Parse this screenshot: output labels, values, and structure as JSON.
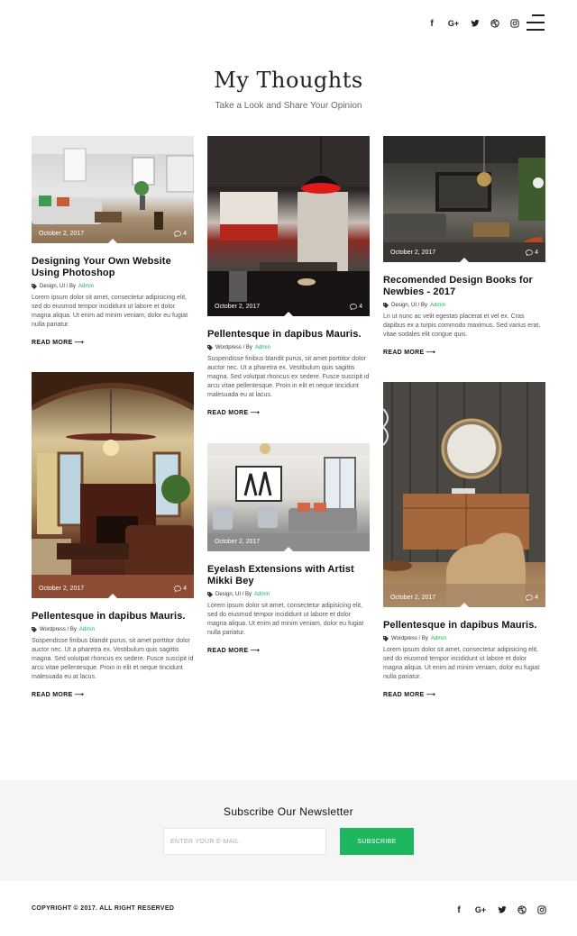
{
  "header": {
    "social": [
      {
        "icon": "facebook-icon",
        "glyph": "f"
      },
      {
        "icon": "google-plus-icon",
        "glyph": "G+"
      },
      {
        "icon": "twitter-icon",
        "glyph": ""
      },
      {
        "icon": "dribbble-icon",
        "glyph": ""
      },
      {
        "icon": "instagram-icon",
        "glyph": ""
      }
    ],
    "menu_icon": "hamburger-menu-icon"
  },
  "hero": {
    "title": "My Thoughts",
    "subtitle": "Take a Look and Share Your Opinion"
  },
  "posts": [
    {
      "date": "October 2, 2017",
      "comments": "4",
      "title": "Designing Your Own Website Using Photoshop",
      "categories": "Design, UI / By",
      "author": "Admin",
      "excerpt": "Lorem ipsum dolor sit amet, consectetur adipisicing elit, sed do eiusmod tempor incididunt ut labore et dolor magna aliqua. Ut enim ad minim veniam, dolor eu fugiat nulla pariatur.",
      "read_more": "READ MORE"
    },
    {
      "date": "October 2, 2017",
      "comments": "4",
      "title": "Pellentesque in dapibus Mauris.",
      "categories": "Wordpress / By",
      "author": "Admin",
      "excerpt": "Suspendisse finibus blandit purus, sit amet porttitor dolor auctor nec. Ut a pharetra ex. Vestibulum quis sagittis magna. Sed volutpat rhoncus ex sedere. Fusce suscipit id arcu vitae pellentesque. Proin in elit et neque tincidunt malesuada eu at lacus.",
      "read_more": "READ MORE"
    },
    {
      "date": "October 2, 2017",
      "comments": "4",
      "title": "Recomended Design Books for Newbies - 2017",
      "categories": "Design, UI / By",
      "author": "Admin",
      "excerpt": "Ln ut nunc ac velit egestas placerat et vel ex. Cras dapibus ex a turpis commodo maximus. Sed varius erat, vitae sodales elit congue quis.",
      "read_more": "READ MORE"
    },
    {
      "date": "October 2, 2017",
      "comments": "4",
      "title": "Pellentesque in dapibus Mauris.",
      "categories": "Wordpress / By",
      "author": "Admin",
      "excerpt": "Suspendisse finibus blandit purus, sit amet porttitor dolor auctor nec. Ut a pharetra ex. Vestibulum quis sagittis magna. Sed volutpat rhoncus ex sedere. Fusce suscipit id arcu vitae pellentesque. Proin in elit et neque tincidunt malesuada eu at lacus.",
      "read_more": "READ MORE"
    },
    {
      "date": "October 2, 2017",
      "comments": "4",
      "title": "Eyelash Extensions with Artist Mikki Bey",
      "categories": "Design, UI / By",
      "author": "Admin",
      "excerpt": "Lorem ipsum dolor sit amet, consectetur adipisicing elit, sed do eiusmod tempor incididunt ut labore et dolor magna aliqua. Ut enim ad minim veniam, dolor eu fugiat nulla pariatur.",
      "read_more": "READ MORE"
    },
    {
      "date": "October 2, 2017",
      "comments": "4",
      "title": "Pellentesque in dapibus Mauris.",
      "categories": "Wordpress / By",
      "author": "Admin",
      "excerpt": "Lorem ipsum dolor sit amet, consectetur adipisicing elit, sed do eiusmod tempor incididunt ut labore et dolor magna aliqua. Ut enim ad minim veniam, dolor eu fugiat nulla pariatur.",
      "read_more": "READ MORE"
    }
  ],
  "newsletter": {
    "title": "Subscribe Our Newsletter",
    "placeholder": "ENTER YOUR E-MAIL",
    "button": "SUBSCRIBE"
  },
  "footer": {
    "copyright": "COPYRIGHT © 2017. ALL RIGHT RESERVED"
  },
  "colors": {
    "accent": "#1eb760",
    "author_link": "#19b45a",
    "newsletter_bg": "#f5f5f5"
  }
}
